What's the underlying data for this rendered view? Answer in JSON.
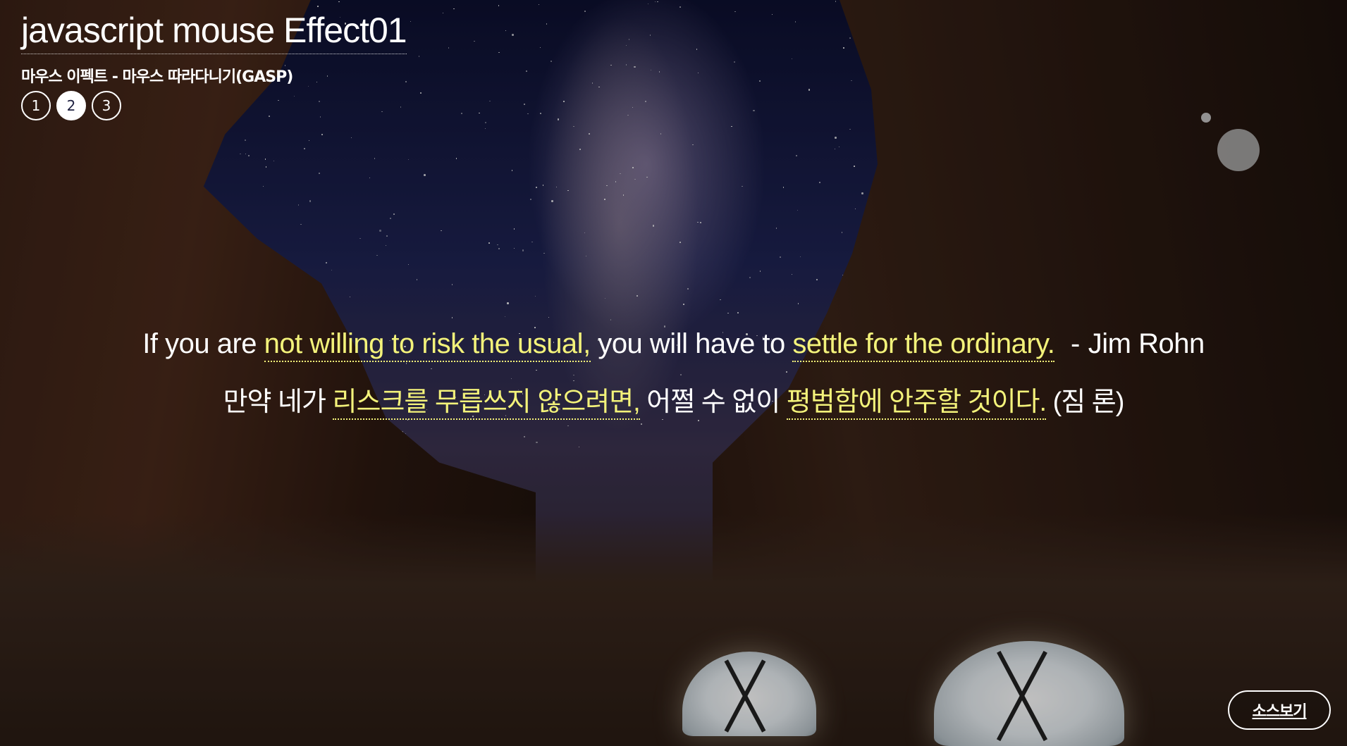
{
  "header": {
    "title": "javascript mouse Effect01",
    "subtitle": "마우스 이펙트 - 마우스 따라다니기(GASP)"
  },
  "pager": {
    "items": [
      "1",
      "2",
      "3"
    ],
    "active": "2"
  },
  "quote": {
    "en": {
      "part1": "If you are",
      "highlight1": "not willing to risk the usual,",
      "part2": "you will have to",
      "highlight2": "settle for the ordinary.",
      "dash": "-",
      "author": "Jim Rohn"
    },
    "ko": {
      "part1": "만약 네가",
      "highlight1": "리스크를 무릅쓰지 않으려면,",
      "part2": "어쩔 수 없이",
      "highlight2": "평범함에 안주할 것이다.",
      "author": "(짐 론)"
    }
  },
  "source_button": {
    "label": "소스보기"
  },
  "colors": {
    "highlight": "#f3f27a",
    "text": "#ffffff"
  }
}
